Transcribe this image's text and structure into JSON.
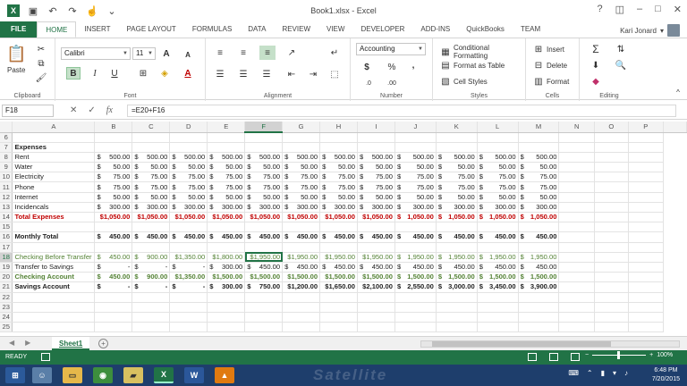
{
  "window": {
    "title": "Book1.xlsx - Excel",
    "user": "Kari Jonard",
    "controls": [
      "?",
      "◫",
      "–",
      "□",
      "✕"
    ]
  },
  "ribbon_tabs": [
    "FILE",
    "HOME",
    "INSERT",
    "PAGE LAYOUT",
    "FORMULAS",
    "DATA",
    "REVIEW",
    "VIEW",
    "DEVELOPER",
    "ADD-INS",
    "QuickBooks",
    "TEAM"
  ],
  "ribbon": {
    "clipboard": {
      "paste": "Paste",
      "label": "Clipboard"
    },
    "font": {
      "name": "Calibri",
      "size": "11",
      "bold": "B",
      "italic": "I",
      "underline": "U",
      "label": "Font"
    },
    "alignment": {
      "label": "Alignment"
    },
    "number": {
      "format": "Accounting",
      "currency": "$",
      "percent": "%",
      "comma": ",",
      "label": "Number"
    },
    "styles": {
      "conditional": "Conditional Formatting",
      "table": "Format as Table",
      "cell": "Cell Styles",
      "label": "Styles"
    },
    "cells": {
      "insert": "Insert",
      "delete": "Delete",
      "format": "Format",
      "label": "Cells"
    },
    "editing": {
      "label": "Editing"
    }
  },
  "formula_bar": {
    "name_box": "F18",
    "formula": "=E20+F16",
    "fx": "fx"
  },
  "columns": [
    "A",
    "B",
    "C",
    "D",
    "E",
    "F",
    "G",
    "H",
    "I",
    "J",
    "K",
    "L",
    "M",
    "N",
    "O",
    "P"
  ],
  "selected_column": "F",
  "rows": [
    {
      "num": "6",
      "label": "",
      "style": "",
      "values": []
    },
    {
      "num": "7",
      "label": "Expenses",
      "style": "bold",
      "values": []
    },
    {
      "num": "8",
      "label": "Rent",
      "style": "",
      "values": [
        "500.00",
        "500.00",
        "500.00",
        "500.00",
        "500.00",
        "500.00",
        "500.00",
        "500.00",
        "500.00",
        "500.00",
        "500.00",
        "500.00"
      ]
    },
    {
      "num": "9",
      "label": "Water",
      "style": "",
      "values": [
        "50.00",
        "50.00",
        "50.00",
        "50.00",
        "50.00",
        "50.00",
        "50.00",
        "50.00",
        "50.00",
        "50.00",
        "50.00",
        "50.00"
      ]
    },
    {
      "num": "10",
      "label": "Electricity",
      "style": "",
      "values": [
        "75.00",
        "75.00",
        "75.00",
        "75.00",
        "75.00",
        "75.00",
        "75.00",
        "75.00",
        "75.00",
        "75.00",
        "75.00",
        "75.00"
      ]
    },
    {
      "num": "11",
      "label": "Phone",
      "style": "",
      "values": [
        "75.00",
        "75.00",
        "75.00",
        "75.00",
        "75.00",
        "75.00",
        "75.00",
        "75.00",
        "75.00",
        "75.00",
        "75.00",
        "75.00"
      ]
    },
    {
      "num": "12",
      "label": "Internet",
      "style": "",
      "values": [
        "50.00",
        "50.00",
        "50.00",
        "50.00",
        "50.00",
        "50.00",
        "50.00",
        "50.00",
        "50.00",
        "50.00",
        "50.00",
        "50.00"
      ]
    },
    {
      "num": "13",
      "label": "Incidencals",
      "style": "",
      "values": [
        "300.00",
        "300.00",
        "300.00",
        "300.00",
        "300.00",
        "300.00",
        "300.00",
        "300.00",
        "300.00",
        "300.00",
        "300.00",
        "300.00"
      ]
    },
    {
      "num": "14",
      "label": "Total Expenses",
      "style": "red",
      "values": [
        "$1,050.00",
        "$1,050.00",
        "$1,050.00",
        "$1,050.00",
        "$1,050.00",
        "$1,050.00",
        "$1,050.00",
        "$1,050.00",
        "1,050.00",
        "1,050.00",
        "1,050.00",
        "1,050.00"
      ]
    },
    {
      "num": "15",
      "label": "",
      "style": "",
      "values": []
    },
    {
      "num": "16",
      "label": "Monthly Total",
      "style": "bold",
      "values": [
        "450.00",
        "450.00",
        "450.00",
        "450.00",
        "450.00",
        "450.00",
        "450.00",
        "450.00",
        "450.00",
        "450.00",
        "450.00",
        "450.00"
      ]
    },
    {
      "num": "17",
      "label": "",
      "style": "",
      "values": []
    },
    {
      "num": "18",
      "label": "Checking Before Transfer",
      "style": "green",
      "values": [
        "450.00",
        "900.00",
        "$1,350.00",
        "$1,800.00",
        "$1,950.00",
        "$1,950.00",
        "$1,950.00",
        "$1,950.00",
        "1,950.00",
        "1,950.00",
        "1,950.00",
        "1,950.00"
      ]
    },
    {
      "num": "19",
      "label": "Transfer to Savings",
      "style": "",
      "values": [
        "-",
        "-",
        "-",
        "300.00",
        "450.00",
        "450.00",
        "450.00",
        "450.00",
        "450.00",
        "450.00",
        "450.00",
        "450.00"
      ]
    },
    {
      "num": "20",
      "label": "Checking Account",
      "style": "greenb",
      "values": [
        "450.00",
        "900.00",
        "$1,350.00",
        "$1,500.00",
        "$1,500.00",
        "$1,500.00",
        "$1,500.00",
        "$1,500.00",
        "1,500.00",
        "1,500.00",
        "1,500.00",
        "1,500.00"
      ]
    },
    {
      "num": "21",
      "label": "Savings Account",
      "style": "bold",
      "values": [
        "-",
        "-",
        "-",
        "300.00",
        "750.00",
        "$1,200.00",
        "$1,650.00",
        "$2,100.00",
        "2,550.00",
        "3,000.00",
        "3,450.00",
        "3,900.00"
      ]
    },
    {
      "num": "22",
      "label": "",
      "style": "",
      "values": []
    },
    {
      "num": "23",
      "label": "",
      "style": "",
      "values": []
    },
    {
      "num": "24",
      "label": "",
      "style": "",
      "values": []
    },
    {
      "num": "25",
      "label": "",
      "style": "",
      "values": []
    }
  ],
  "selected_row": "18",
  "active_cell": {
    "row": "18",
    "col": 5
  },
  "sheet_tabs": [
    "Sheet1"
  ],
  "status": {
    "text": "READY",
    "zoom": "100%"
  },
  "taskbar": {
    "watermark": "Satellite",
    "time": "6:48 PM",
    "date": "7/20/2015"
  },
  "colors": {
    "excel_green": "#217346",
    "total_red": "#c00000",
    "accent_green": "#548235",
    "taskbar": "#1e3e6c"
  }
}
